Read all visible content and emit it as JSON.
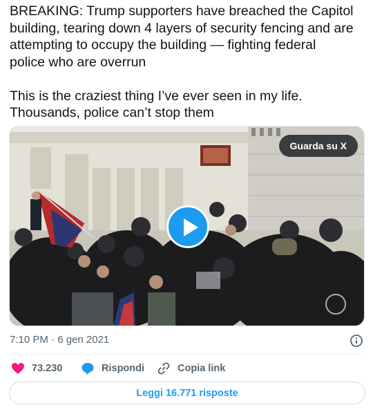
{
  "tweet": {
    "text": "BREAKING: Trump supporters have breached the Capitol\nbuilding, tearing down 4 layers of security fencing and are\nattempting to occupy the building — fighting federal\npolice who are overrun\n\nThis is the craziest thing I’ve ever seen in my life.\nThousands, police can’t stop them",
    "timestamp": "7:10 PM · 6 gen 2021"
  },
  "media": {
    "watch_label": "Guarda su X",
    "play_icon": "play-icon"
  },
  "actions": {
    "likes": "73.230",
    "reply_label": "Rispondi",
    "copy_label": "Copia link"
  },
  "replies_button": "Leggi 16.771 risposte",
  "colors": {
    "accent": "#1d9bf0",
    "like": "#f91880",
    "secondary_text": "#536471"
  }
}
